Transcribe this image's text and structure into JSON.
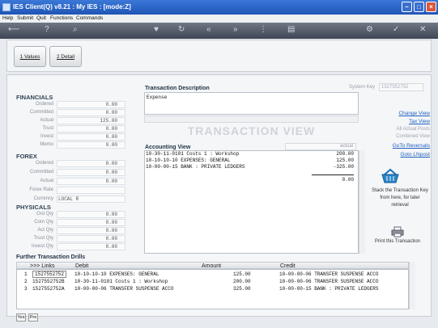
{
  "window": {
    "title": "IES Client(Q) v8.21 : My IES :       [mode:Z]"
  },
  "menu": [
    "Help",
    "Submit",
    "Quit",
    "Functions",
    "Commands"
  ],
  "tabs": [
    {
      "label": "1 Values"
    },
    {
      "label": "2 Detail"
    }
  ],
  "financials": {
    "heading": "FINANCIALS",
    "rows": [
      {
        "label": "Ordered",
        "value": "0.00"
      },
      {
        "label": "Committed",
        "value": "0.00"
      },
      {
        "label": "Actual",
        "value": "125.00"
      },
      {
        "label": "Trust",
        "value": "0.00"
      },
      {
        "label": "Invest",
        "value": "0.00"
      },
      {
        "label": "Memo",
        "value": "0.00"
      }
    ]
  },
  "forex": {
    "heading": "FOREX",
    "rows": [
      {
        "label": "Ordered",
        "value": "0.00"
      },
      {
        "label": "Committed",
        "value": "0.00"
      },
      {
        "label": "Actual",
        "value": "0.00"
      },
      {
        "label": "Forex Rate",
        "value": ""
      },
      {
        "label": "Currency",
        "value": "LOCAL R"
      }
    ]
  },
  "physicals": {
    "heading": "PHYSICALS",
    "rows": [
      {
        "label": "Ord Qty",
        "value": "0.00"
      },
      {
        "label": "Com Qty",
        "value": "0.00"
      },
      {
        "label": "Act Qty",
        "value": "0.00"
      },
      {
        "label": "Trust Qty",
        "value": "0.00"
      },
      {
        "label": "Invest Qty",
        "value": "0.00"
      }
    ]
  },
  "transaction": {
    "desc_label": "Transaction Description",
    "desc_value": "Expense",
    "system_key_label": "System Key",
    "system_key_value": "1527552752",
    "view_title": "TRANSACTION VIEW",
    "accounting_label": "Accounting View",
    "mode_value": "actual",
    "lines": [
      {
        "account": "10-30-11-0101 Costs 1 : Workshop",
        "amount": "200.00"
      },
      {
        "account": "10-10-10-10 EXPENSES: GENERAL",
        "amount": "125.00"
      },
      {
        "account": "10-00-00-15 BANK : PRIVATE LEDGERS",
        "amount": "-325.00"
      }
    ],
    "total": "0.00"
  },
  "side_links": {
    "change_view": "Change View",
    "tax_view": "Tax View",
    "dim1": "All Actual Posts",
    "dim2": "Combined View",
    "goto_reversals": "GoTo Reversals",
    "goto_link": "Goto LNpost",
    "basket_note": "Stack the Transaction Key from here, for later retrieval",
    "print_note": "Print this Transaction"
  },
  "drills": {
    "heading": "Further Transaction Drills",
    "columns": [
      ">>> Links",
      "Debit",
      "Amount",
      "Credit"
    ],
    "rows": [
      {
        "n": "1",
        "link": "1527552752",
        "debit": "10-10-10-10 EXPENSES: GENERAL",
        "amount": "125.00",
        "credit": "10-00-00-06 TRANSFER SUSPENSE ACCO"
      },
      {
        "n": "2",
        "link": "1527552752B",
        "debit": "10-30-11-0101 Costs 1 : Workshop",
        "amount": "200.00",
        "credit": "10-00-00-06 TRANSFER SUSPENSE ACCO"
      },
      {
        "n": "3",
        "link": "1527552752A",
        "debit": "10-00-00-06 TRANSFER SUSPENSE ACCO",
        "amount": "325.00",
        "credit": "10-00-00-15 BANK : PRIVATE LEDGERS"
      }
    ]
  },
  "bottom": {
    "yes": "Yes",
    "no": "Pre"
  },
  "icons": {
    "home": "back-arrow-icon",
    "help": "help-icon",
    "search": "search-icon",
    "basket": "basket-icon",
    "printer": "printer-icon"
  }
}
